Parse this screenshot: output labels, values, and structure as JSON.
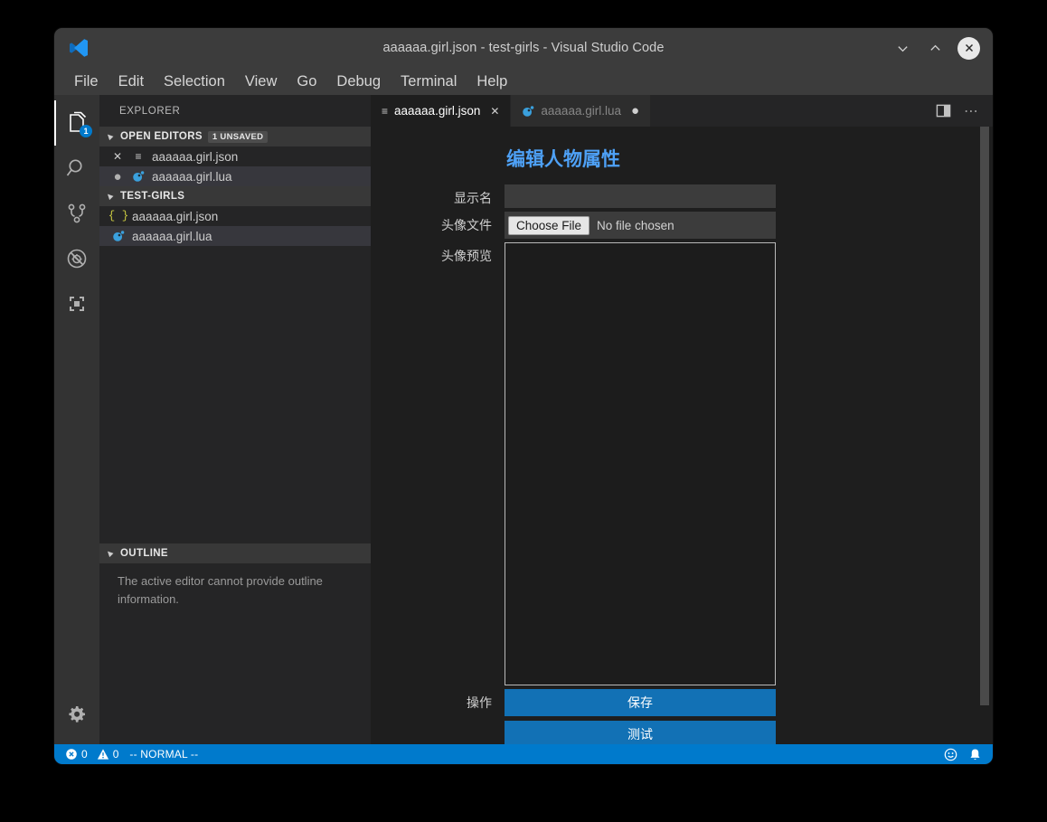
{
  "window": {
    "title": "aaaaaa.girl.json - test-girls - Visual Studio Code",
    "minimize_label": "⌄",
    "maximize_label": "⌃",
    "close_label": "✕"
  },
  "menubar": {
    "items": [
      {
        "label": "File"
      },
      {
        "label": "Edit"
      },
      {
        "label": "Selection"
      },
      {
        "label": "View"
      },
      {
        "label": "Go"
      },
      {
        "label": "Debug"
      },
      {
        "label": "Terminal"
      },
      {
        "label": "Help"
      }
    ]
  },
  "activitybar": {
    "items": [
      {
        "name": "explorer",
        "icon": "files-icon",
        "badge": "1",
        "active": true
      },
      {
        "name": "search",
        "icon": "search-icon",
        "badge": "",
        "active": false
      },
      {
        "name": "source-control",
        "icon": "source-control-icon",
        "badge": "",
        "active": false
      },
      {
        "name": "debug",
        "icon": "debug-disabled-icon",
        "badge": "",
        "active": false
      },
      {
        "name": "extensions",
        "icon": "extensions-icon",
        "badge": "",
        "active": false
      }
    ],
    "settings_icon": "gear-icon"
  },
  "sidebar": {
    "title": "EXPLORER",
    "open_editors": {
      "header": "OPEN EDITORS",
      "badge": "1 UNSAVED",
      "items": [
        {
          "label": "aaaaaa.girl.json",
          "state_icon": "close-icon",
          "file_icon": "json-lines-icon",
          "selected": false
        },
        {
          "label": "aaaaaa.girl.lua",
          "state_icon": "dirty-dot-icon",
          "file_icon": "lua-icon",
          "selected": true
        }
      ]
    },
    "folder": {
      "header": "TEST-GIRLS",
      "items": [
        {
          "label": "aaaaaa.girl.json",
          "file_icon": "json-icon",
          "selected": false
        },
        {
          "label": "aaaaaa.girl.lua",
          "file_icon": "lua-icon",
          "selected": true
        }
      ]
    },
    "outline": {
      "header": "OUTLINE",
      "message": "The active editor cannot provide outline information."
    }
  },
  "editor": {
    "tabs": [
      {
        "label": "aaaaaa.girl.json",
        "icon": "json-lines-icon",
        "active": true,
        "dirty": false,
        "closable": true
      },
      {
        "label": "aaaaaa.girl.lua",
        "icon": "lua-icon",
        "active": false,
        "dirty": true,
        "closable": false
      }
    ],
    "actions": [
      {
        "name": "split-editor-icon"
      },
      {
        "name": "more-actions-icon",
        "label": "⋯"
      }
    ]
  },
  "form": {
    "title": "编辑人物属性",
    "display_name": {
      "label": "显示名",
      "value": "",
      "placeholder": ""
    },
    "avatar_file": {
      "label": "头像文件",
      "button": "Choose File",
      "status": "No file chosen"
    },
    "avatar_preview": {
      "label": "头像预览"
    },
    "actions": {
      "label": "操作",
      "save": "保存",
      "test": "测试"
    }
  },
  "statusbar": {
    "errors": "0",
    "warnings": "0",
    "mode": "-- NORMAL --",
    "right_items": [
      {
        "name": "feedback-smiley-icon"
      },
      {
        "name": "notifications-bell-icon"
      }
    ]
  },
  "colors": {
    "accent": "#007acc",
    "button": "#1271b5",
    "heading": "#4ea1f7",
    "titlebar": "#3c3c3c",
    "sidebar": "#252526",
    "editor": "#1e1e1e"
  }
}
